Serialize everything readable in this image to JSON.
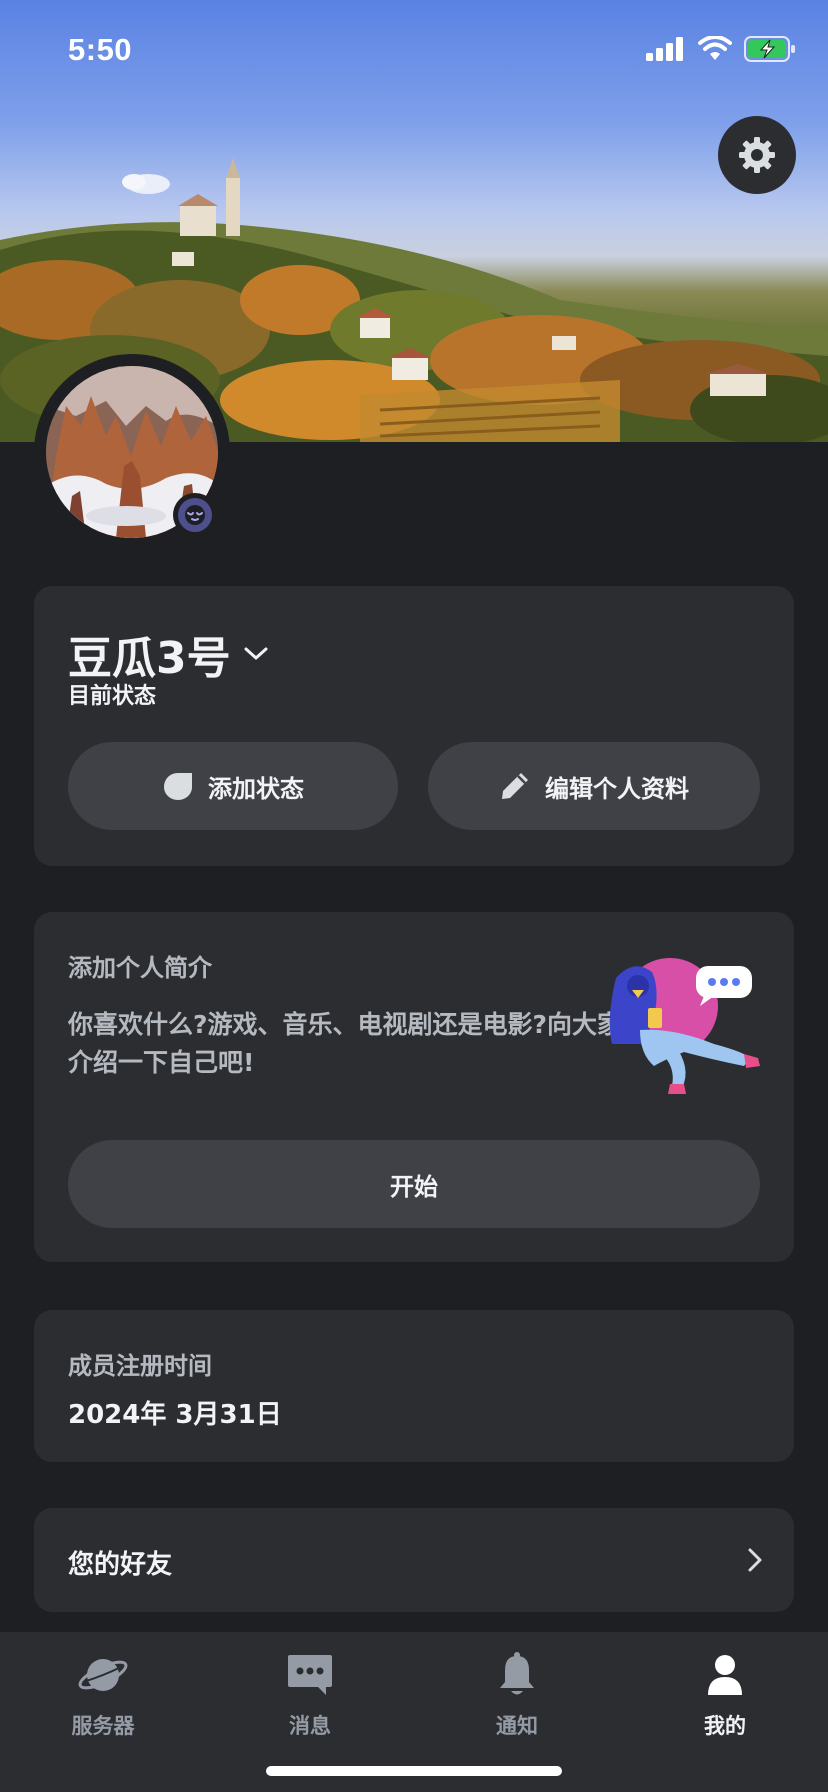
{
  "status_bar": {
    "time": "5:50"
  },
  "profile": {
    "display_name": "豆瓜3号",
    "status_label": "目前状态",
    "add_status_label": "添加状态",
    "edit_profile_label": "编辑个人资料"
  },
  "bio": {
    "title": "添加个人简介",
    "text": "你喜欢什么?游戏、音乐、电视剧还是电影?向大家介绍一下自己吧!",
    "start_label": "开始"
  },
  "member": {
    "title": "成员注册时间",
    "date": "2024年 3月31日"
  },
  "friends": {
    "label": "您的好友"
  },
  "nav": {
    "items": [
      {
        "label": "服务器",
        "icon": "planet-icon",
        "active": false
      },
      {
        "label": "消息",
        "icon": "chat-icon",
        "active": false
      },
      {
        "label": "通知",
        "icon": "bell-icon",
        "active": false
      },
      {
        "label": "我的",
        "icon": "user-icon",
        "active": true
      }
    ]
  },
  "colors": {
    "background": "#1e1f22",
    "card": "#2b2d31",
    "button": "#3f4147",
    "text_primary": "#f2f3f5",
    "text_muted": "#b5bac1",
    "nav_inactive": "#949ba4",
    "battery_green": "#34c759"
  }
}
